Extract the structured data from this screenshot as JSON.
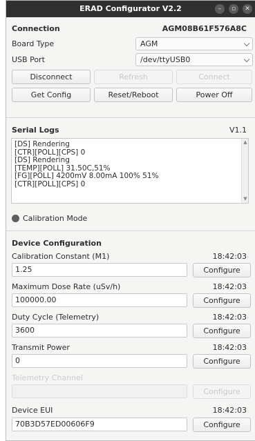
{
  "window": {
    "title": "ERAD Configurator V2.2"
  },
  "connection": {
    "heading": "Connection",
    "device_id": "AGM08B61F576A8C",
    "board_type_label": "Board Type",
    "board_type_value": "AGM",
    "usb_port_label": "USB Port",
    "usb_port_value": "/dev/ttyUSB0",
    "disconnect_label": "Disconnect",
    "refresh_label": "Refresh",
    "connect_label": "Connect",
    "get_config_label": "Get Config",
    "reset_reboot_label": "Reset/Reboot",
    "power_off_label": "Power Off"
  },
  "serial_logs": {
    "heading": "Serial Logs",
    "version": "V1.1",
    "lines": [
      "[DS] Rendering",
      "[CTR][POLL][CPS] 0",
      "[DS] Rendering",
      "[TEMP][POLL] 31.50C,51%",
      "[FG][POLL] 4200mV 8.00mA 100% 51%",
      "[CTR][POLL][CPS] 0"
    ]
  },
  "calibration_mode_label": "Calibration Mode",
  "device_config": {
    "heading": "Device Configuration",
    "configure_label": "Configure",
    "params": [
      {
        "label": "Calibration Constant (M1)",
        "time": "18:42:03",
        "value": "1.25",
        "enabled": true
      },
      {
        "label": "Maximum Dose Rate (uSv/h)",
        "time": "18:42:03",
        "value": "100000.00",
        "enabled": true
      },
      {
        "label": "Duty Cycle (Telemetry)",
        "time": "18:42:03",
        "value": "3600",
        "enabled": true
      },
      {
        "label": "Transmit Power",
        "time": "18:42:03",
        "value": "0",
        "enabled": true
      },
      {
        "label": "Telemetry Channel",
        "time": "",
        "value": "",
        "enabled": false
      },
      {
        "label": "Device EUI",
        "time": "18:42:03",
        "value": "70B3D57ED00606F9",
        "enabled": true
      }
    ]
  }
}
